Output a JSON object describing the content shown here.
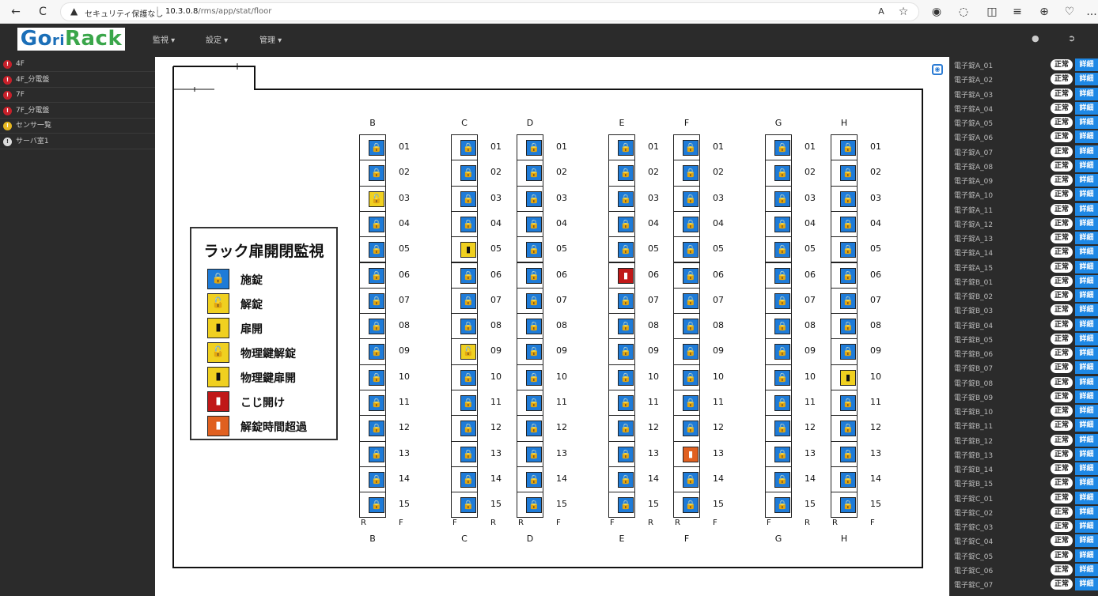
{
  "browser": {
    "security": "セキュリティ保護なし",
    "separator": "|",
    "url_host": "10.3.0.8",
    "url_path": "/rms/app/stat/floor",
    "back": "←",
    "reload": "C",
    "read_aloud": "A",
    "favorite": "☆",
    "more": "..."
  },
  "nav": {
    "menus": [
      "監視 ▾",
      "設定 ▾",
      "管理 ▾"
    ],
    "user_icon": "user-icon",
    "logout_icon": "logout-icon"
  },
  "logo": {
    "part1": "Go",
    "part2": "ri",
    "part3": "Rack"
  },
  "sidebar": {
    "items": [
      {
        "label": "4F",
        "pin": "red"
      },
      {
        "label": "4F_分電盤",
        "pin": "red"
      },
      {
        "label": "7F",
        "pin": "red"
      },
      {
        "label": "7F_分電盤",
        "pin": "red"
      },
      {
        "label": "センサ一覧",
        "pin": "yellow"
      },
      {
        "label": "サーバ室1",
        "pin": "white"
      }
    ]
  },
  "legend": {
    "title": "ラック扉開閉監視",
    "items": [
      {
        "label": "施錠",
        "color": "#1e7bd8",
        "glyph": "🔒"
      },
      {
        "label": "解錠",
        "color": "#f0d020",
        "glyph": "🔓"
      },
      {
        "label": "扉開",
        "color": "#f0d020",
        "glyph": "▮"
      },
      {
        "label": "物理鍵解錠",
        "color": "#f0d020",
        "glyph": "🔓"
      },
      {
        "label": "物理鍵扉開",
        "color": "#f0d020",
        "glyph": "▮"
      },
      {
        "label": "こじ開け",
        "color": "#c01818",
        "glyph": "▮"
      },
      {
        "label": "解錠時間超過",
        "color": "#e06020",
        "glyph": "▮"
      }
    ]
  },
  "racks": {
    "rows": [
      "01",
      "02",
      "03",
      "04",
      "05",
      "06",
      "07",
      "08",
      "09",
      "10",
      "11",
      "12",
      "13",
      "14",
      "15"
    ],
    "columns": [
      {
        "name": "B",
        "top": "B",
        "bottom": "B",
        "left": "R",
        "right": "F",
        "states": {
          "03": "unlocked"
        }
      },
      {
        "name": "C",
        "top": "C",
        "bottom": "C",
        "left": "F",
        "right": "R",
        "states": {
          "05": "door_open",
          "09": "physical_unlocked"
        }
      },
      {
        "name": "D",
        "top": "D",
        "bottom": "D",
        "left": "R",
        "right": "F",
        "states": {}
      },
      {
        "name": "E",
        "top": "E",
        "bottom": "E",
        "left": "F",
        "right": "R",
        "states": {
          "06": "forced"
        }
      },
      {
        "name": "F",
        "top": "F",
        "bottom": "F",
        "left": "R",
        "right": "F",
        "states": {
          "13": "overtime"
        }
      },
      {
        "name": "G",
        "top": "G",
        "bottom": "G",
        "left": "F",
        "right": "R",
        "states": {}
      },
      {
        "name": "H",
        "top": "H",
        "bottom": "H",
        "left": "R",
        "right": "F",
        "states": {
          "10": "physical_door_open"
        }
      }
    ]
  },
  "rightpanel": {
    "ok_label": "正常",
    "detail_label": "詳細",
    "items": [
      "電子錠A_01",
      "電子錠A_02",
      "電子錠A_03",
      "電子錠A_04",
      "電子錠A_05",
      "電子錠A_06",
      "電子錠A_07",
      "電子錠A_08",
      "電子錠A_09",
      "電子錠A_10",
      "電子錠A_11",
      "電子錠A_12",
      "電子錠A_13",
      "電子錠A_14",
      "電子錠A_15",
      "電子錠B_01",
      "電子錠B_02",
      "電子錠B_03",
      "電子錠B_04",
      "電子錠B_05",
      "電子錠B_06",
      "電子錠B_07",
      "電子錠B_08",
      "電子錠B_09",
      "電子錠B_10",
      "電子錠B_11",
      "電子錠B_12",
      "電子錠B_13",
      "電子錠B_14",
      "電子錠B_15",
      "電子錠C_01",
      "電子錠C_02",
      "電子錠C_03",
      "電子錠C_04",
      "電子錠C_05",
      "電子錠C_06",
      "電子錠C_07"
    ]
  }
}
